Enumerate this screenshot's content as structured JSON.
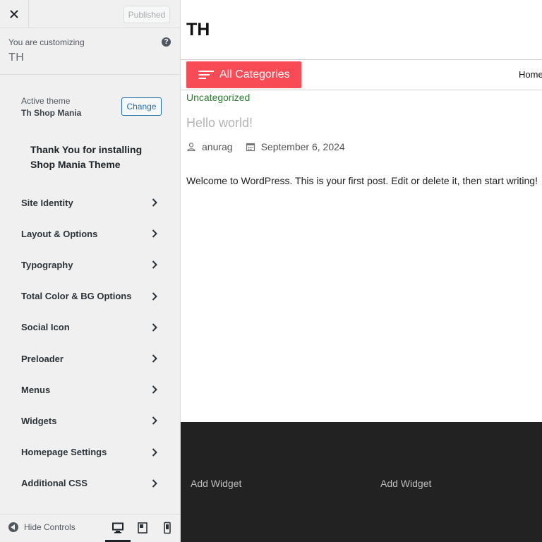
{
  "sidebar": {
    "published_label": "Published",
    "customizing_label": "You are customizing",
    "site_name": "TH",
    "help_glyph": "?",
    "active_theme_label": "Active theme",
    "active_theme_name": "Th Shop Mania",
    "change_label": "Change",
    "thanks_text": "Thank You for installing Shop Mania Theme",
    "menu": [
      {
        "label": "Site Identity"
      },
      {
        "label": "Layout & Options"
      },
      {
        "label": "Typography"
      },
      {
        "label": "Total Color & BG Options"
      },
      {
        "label": "Social Icon"
      },
      {
        "label": "Preloader"
      },
      {
        "label": "Menus"
      },
      {
        "label": "Widgets"
      },
      {
        "label": "Homepage Settings"
      },
      {
        "label": "Additional CSS"
      }
    ],
    "hide_controls_label": "Hide Controls"
  },
  "preview": {
    "site_title": "TH",
    "all_categories_label": "All Categories",
    "nav_home": "Home",
    "post_category": "Uncategorized",
    "post_title": "Hello world!",
    "post_author": "anurag",
    "post_date": "September 6, 2024",
    "post_excerpt": "Welcome to WordPress. This is your first post. Edit or delete it, then start writing!",
    "footer_widget_1": "Add Widget",
    "footer_widget_2": "Add Widget"
  },
  "colors": {
    "accent": "#f94b55",
    "link_blue": "#2271b1",
    "category_green": "#2e7d32",
    "footer_bg": "#222222"
  },
  "icons": [
    "close-icon",
    "help-icon",
    "chevron-right-icon",
    "hide-controls-icon",
    "desktop-icon",
    "tablet-icon",
    "mobile-icon",
    "hamburger-icon",
    "user-icon",
    "calendar-icon"
  ]
}
